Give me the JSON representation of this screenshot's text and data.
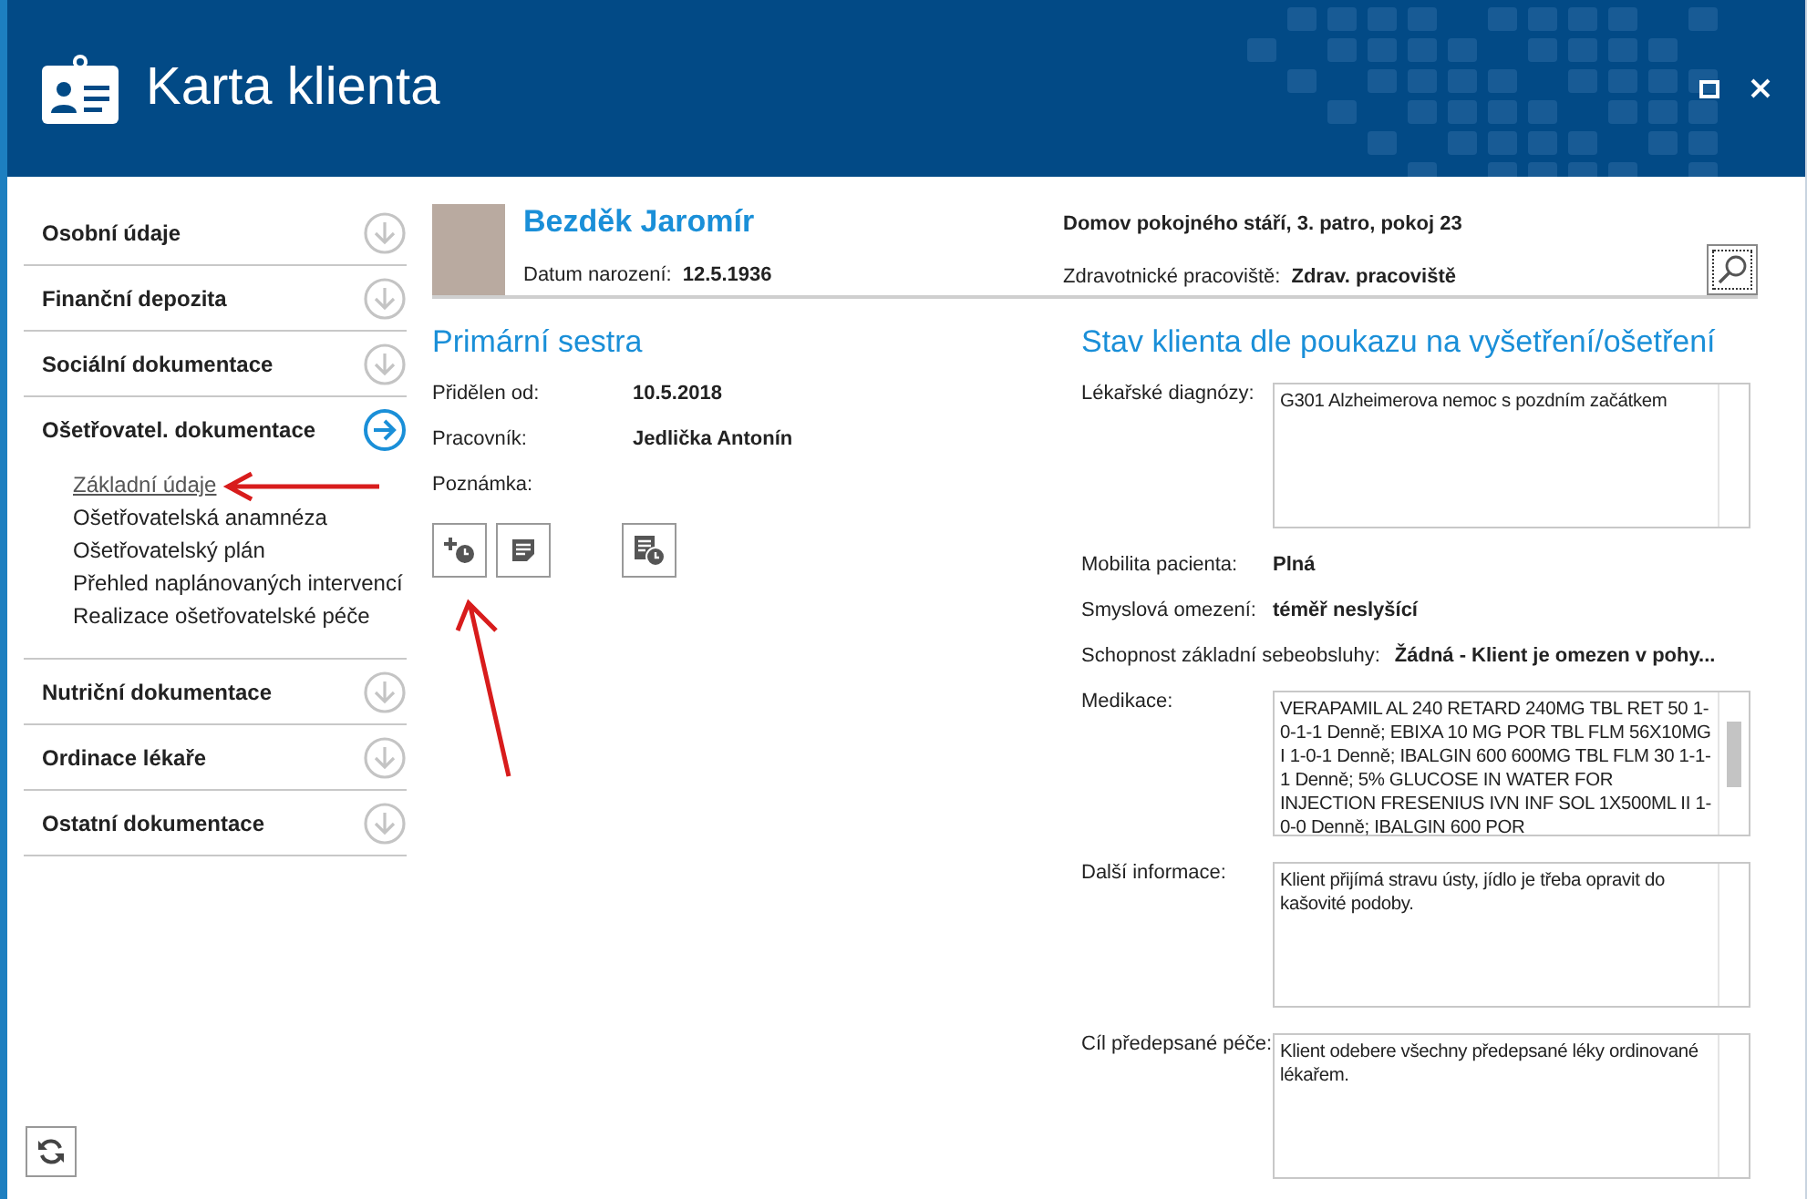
{
  "window": {
    "title": "Karta klienta"
  },
  "sidebar": {
    "sections": [
      {
        "label": "Osobní údaje",
        "expanded": false
      },
      {
        "label": "Finanční depozita",
        "expanded": false
      },
      {
        "label": "Sociální dokumentace",
        "expanded": false
      },
      {
        "label": "Ošetřovatel. dokumentace",
        "expanded": true,
        "children": [
          {
            "label": "Základní údaje",
            "selected": true
          },
          {
            "label": "Ošetřovatelská anamnéza",
            "selected": false
          },
          {
            "label": "Ošetřovatelský plán",
            "selected": false
          },
          {
            "label": "Přehled naplánovaných intervencí",
            "selected": false
          },
          {
            "label": "Realizace ošetřovatelské péče",
            "selected": false
          }
        ]
      },
      {
        "label": "Nutriční dokumentace",
        "expanded": false
      },
      {
        "label": "Ordinace lékaře",
        "expanded": false
      },
      {
        "label": "Ostatní dokumentace",
        "expanded": false
      }
    ]
  },
  "client": {
    "name": "Bezděk Jaromír",
    "birth_label": "Datum narození:",
    "birth_value": "12.5.1936",
    "address": "Domov pokojného stáří, 3. patro, pokoj 23",
    "workplace_label": "Zdravotnické pracoviště:",
    "workplace_value": "Zdrav. pracoviště"
  },
  "primary_nurse": {
    "title": "Primární sestra",
    "fields": [
      {
        "label": "Přidělen od:",
        "value": "10.5.2018"
      },
      {
        "label": "Pracovník:",
        "value": "Jedlička Antonín"
      },
      {
        "label": "Poznámka:"
      }
    ]
  },
  "status": {
    "title": "Stav klienta dle poukazu na vyšetření/ošetření",
    "fields": [
      {
        "kind": "area",
        "label": "Lékařské diagnózy:",
        "value": "G301 Alzheimerova nemoc s pozdním začátkem",
        "scrollable": false
      },
      {
        "kind": "text",
        "label": "Mobilita pacienta:",
        "value": "Plná"
      },
      {
        "kind": "text",
        "label": "Smyslová omezení:",
        "value": "téměř neslyšící"
      },
      {
        "kind": "text",
        "label": "Schopnost základní sebeobsluhy:",
        "value": "Žádná - Klient je omezen v pohy..."
      },
      {
        "kind": "area",
        "label": "Medikace:",
        "value": "VERAPAMIL AL 240 RETARD 240MG TBL RET 50 1-0-1-1 Denně; EBIXA 10 MG POR TBL FLM 56X10MG I 1-0-1 Denně; IBALGIN 600 600MG TBL FLM 30 1-1-1 Denně; 5% GLUCOSE IN WATER FOR INJECTION FRESENIUS IVN INF SOL 1X500ML II 1-0-0 Denně; IBALGIN 600 POR",
        "scrollable": true
      },
      {
        "kind": "area",
        "label": "Další informace:",
        "value": "Klient přijímá stravu ústy, jídlo je třeba opravit do kašovité podoby.",
        "scrollable": false
      },
      {
        "kind": "area",
        "label": "Cíl předepsané péče:",
        "value": "Klient odebere všechny předepsané léky ordinované lékařem.",
        "scrollable": false
      }
    ]
  }
}
